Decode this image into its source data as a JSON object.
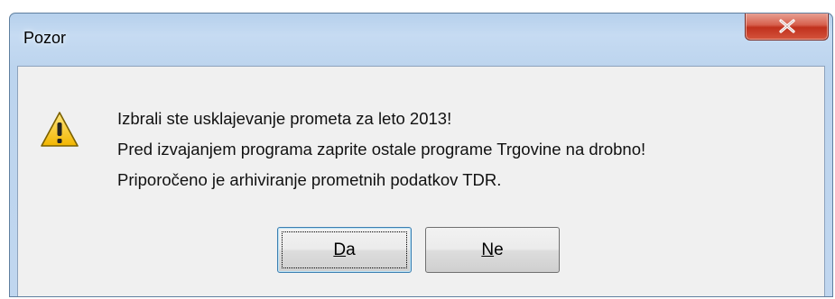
{
  "window": {
    "title": "Pozor",
    "close_glyph": "X"
  },
  "icon": "warning-icon",
  "messages": [
    "Izbrali ste usklajevanje prometa za leto 2013!",
    "Pred izvajanjem programa zaprite ostale programe Trgovine na drobno!",
    "Priporočeno je arhiviranje prometnih podatkov TDR."
  ],
  "buttons": {
    "yes": {
      "mnemonic": "D",
      "rest": "a"
    },
    "no": {
      "mnemonic": "N",
      "rest": "e"
    }
  },
  "colors": {
    "accent": "#3c7fb1",
    "close": "#c0311d",
    "warning": "#f6c500"
  }
}
